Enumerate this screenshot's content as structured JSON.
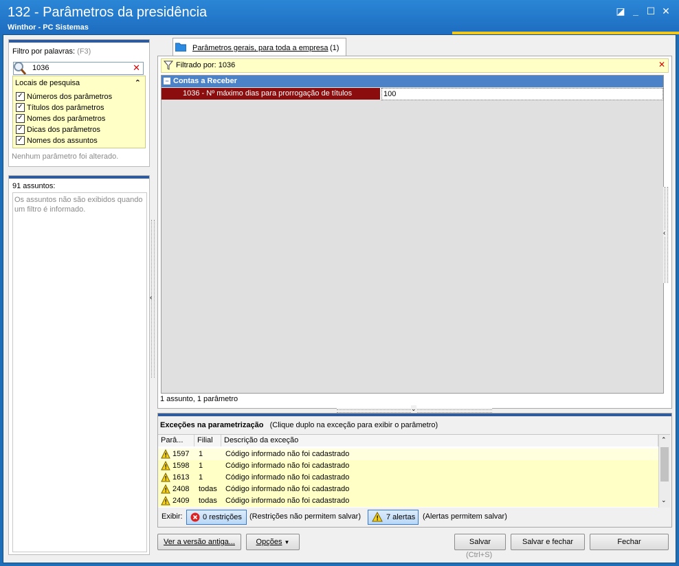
{
  "window": {
    "title": "132 - Parâmetros da presidência",
    "subtitle": "Winthor - PC Sistemas"
  },
  "filter": {
    "label": "Filtro por palavras:",
    "shortcut": "(F3)",
    "value": "1036",
    "locations_title": "Locais de pesquisa",
    "options": [
      {
        "label": "Números dos parâmetros",
        "checked": true
      },
      {
        "label": "Títulos dos parâmetros",
        "checked": true
      },
      {
        "label": "Nomes dos parâmetros",
        "checked": true
      },
      {
        "label": "Dicas dos parâmetros",
        "checked": true
      },
      {
        "label": "Nomes dos assuntos",
        "checked": true
      }
    ],
    "status": "Nenhum parâmetro foi alterado."
  },
  "subjects": {
    "count_label": "91 assuntos:",
    "note": "Os assuntos não são exibidos quando um filtro é informado."
  },
  "tab": {
    "label": "Parâmetros gerais, para toda a empresa",
    "count": "(1)"
  },
  "filtered": {
    "label": "Filtrado por: 1036"
  },
  "grid": {
    "group": "Contas a Receber",
    "param_label": "1036 - Nº máximo dias para prorrogação de títulos",
    "param_value": "100",
    "footer": "1 assunto, 1 parâmetro"
  },
  "exceptions": {
    "title": "Exceções na parametrização",
    "hint": "(Clique duplo na exceção para exibir o parâmetro)",
    "columns": [
      "Parâ...",
      "Filial",
      "Descrição da exceção"
    ],
    "rows": [
      {
        "param": "1597",
        "filial": "1",
        "desc": "Código informado não foi cadastrado"
      },
      {
        "param": "1598",
        "filial": "1",
        "desc": "Código informado não foi cadastrado"
      },
      {
        "param": "1613",
        "filial": "1",
        "desc": "Código informado não foi cadastrado"
      },
      {
        "param": "2408",
        "filial": "todas",
        "desc": "Código informado não foi cadastrado"
      },
      {
        "param": "2409",
        "filial": "todas",
        "desc": "Código informado não foi cadastrado"
      }
    ],
    "show_label": "Exibir:",
    "restrictions_btn": "0 restrições",
    "restrictions_note": "(Restrições não permitem salvar)",
    "alerts_btn": "7 alertas",
    "alerts_note": "(Alertas permitem salvar)"
  },
  "buttons": {
    "old_version": "Ver a versão antiga...",
    "options": "Opções",
    "save": "Salvar",
    "save_shortcut": "(Ctrl+S)",
    "save_close": "Salvar e fechar",
    "close": "Fechar"
  },
  "colors": {
    "title_bar": "#1d6cc0",
    "group_header": "#4b82c8",
    "selected_param": "#8b0d0d",
    "highlight_yellow": "#ffffc6"
  }
}
